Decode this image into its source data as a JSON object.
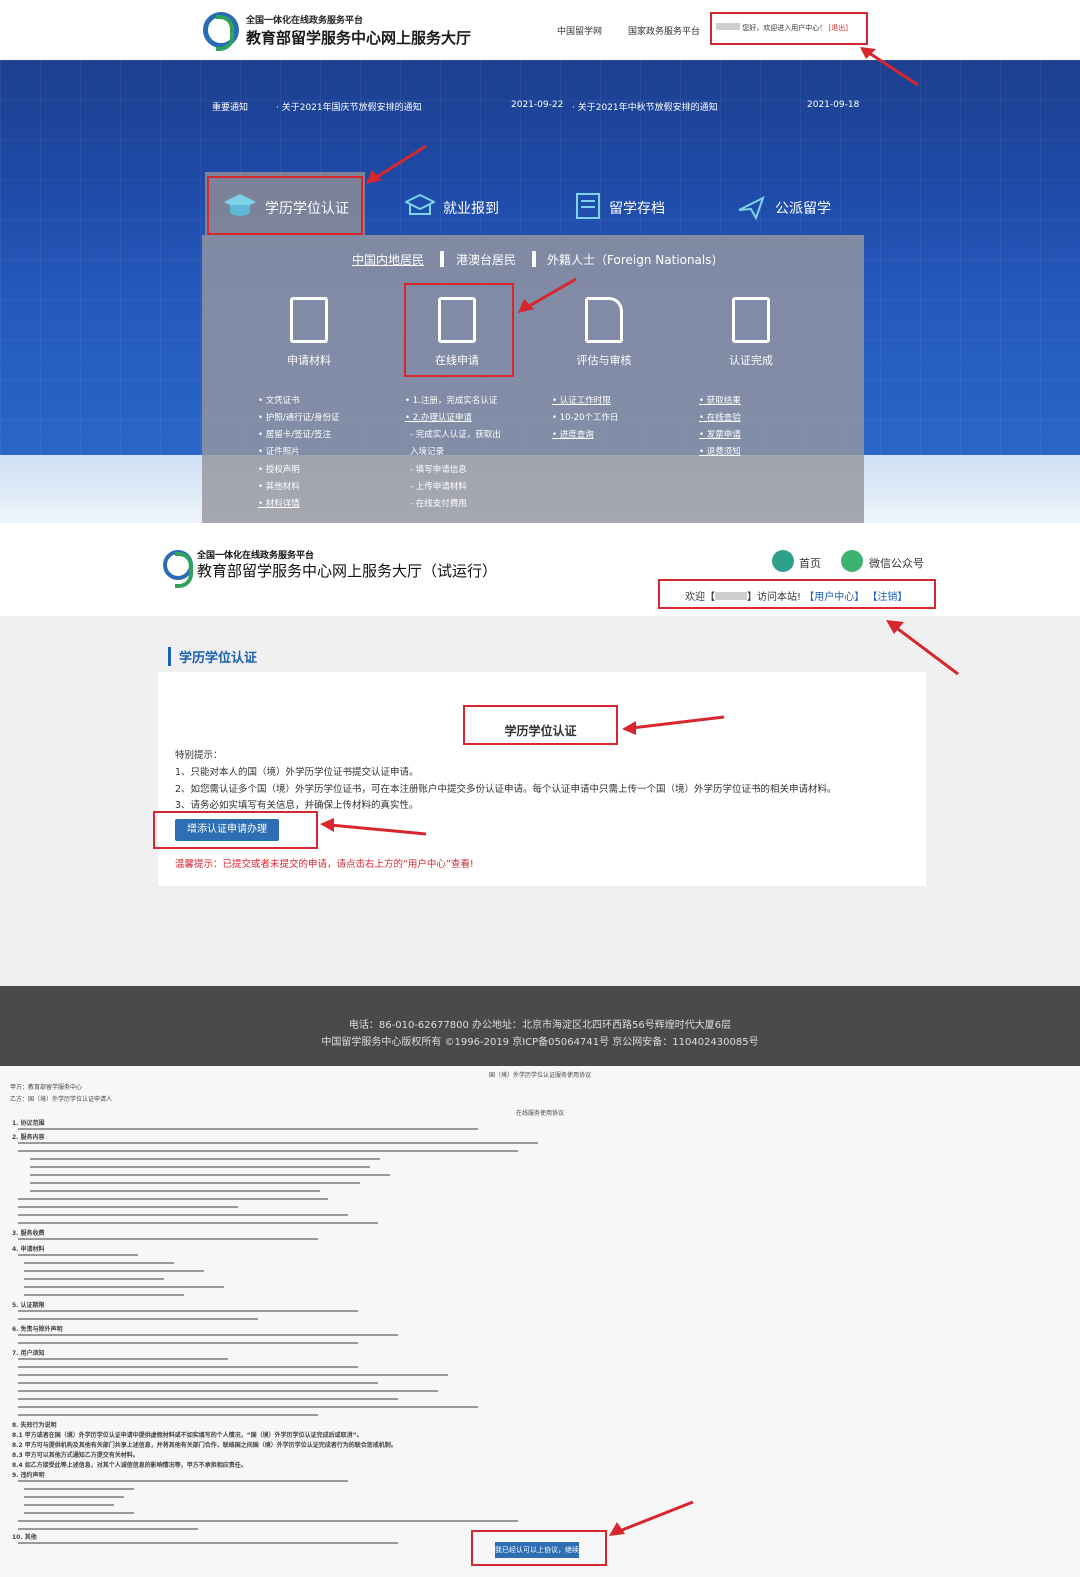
{
  "s1": {
    "logo_sub": "全国一体化在线政务服务平台",
    "logo_main": "教育部留学服务中心网上服务大厅",
    "nav": [
      "中国留学网",
      "国家政务服务平台"
    ],
    "user_greeting": "您好，欢迎进入用户中心！",
    "logout": "[退出]",
    "notice_label": "重要通知",
    "notices": [
      {
        "text": "· 关于2021年国庆节放假安排的通知",
        "date": "2021-09-22"
      },
      {
        "text": "· 关于2021年中秋节放假安排的通知",
        "date": "2021-09-18"
      }
    ],
    "tabs": [
      "学历学位认证",
      "就业报到",
      "留学存档",
      "公派留学"
    ],
    "categories": [
      "中国内地居民",
      "港澳台居民",
      "外籍人士（Foreign Nationals)"
    ],
    "steps": [
      "申请材料",
      "在线申请",
      "评估与审核",
      "认证完成"
    ],
    "col1": [
      "• 文凭证书",
      "• 护照/通行证/身份证",
      "• 居留卡/签证/签注",
      "• 证件照片",
      "• 授权声明",
      "• 其他材料",
      "• 材料详情"
    ],
    "col2": [
      "• 1.注册，完成实名认证",
      "• 2.办理认证申请",
      "- 完成实人认证，获取出",
      "入境记录",
      "- 填写申请信息",
      "- 上传申请材料",
      "- 在线支付费用"
    ],
    "col3": [
      "• 认证工作时限",
      "• 10-20个工作日",
      "• 进度查询"
    ],
    "col4": [
      "• 获取结果",
      "• 在线查验",
      "• 发票申请",
      "• 退费须知"
    ]
  },
  "s2": {
    "logo_sub": "全国一体化在线政务服务平台",
    "logo_main": "教育部留学服务中心网上服务大厅（试运行）",
    "home": "首页",
    "wechat": "微信公众号",
    "welcome_pre": "欢迎【",
    "welcome_post": "】访问本站!",
    "user_center": "【用户中心】",
    "logout": "【注销】",
    "section_title": "学历学位认证",
    "card_title": "学历学位认证",
    "tip_title": "特别提示：",
    "tips": [
      "1、只能对本人的国（境）外学历学位证书提交认证申请。",
      "2、如您需认证多个国（境）外学历学位证书，可在本注册账户中提交多份认证申请。每个认证申请中只需上传一个国（境）外学历学位证书的相关申请材料。",
      "3、请务必如实填写有关信息，并确保上传材料的真实性。"
    ],
    "add_button": "增添认证申请办理",
    "warn": "温馨提示：已提交或者未提交的申请，请点击右上方的“用户中心”查看!"
  },
  "footer": {
    "line1": "电话：86-010-62677800     办公地址：北京市海淀区北四环西路56号辉煌时代大厦6层",
    "line2": "中国留学服务中心版权所有 ©1996-2019     京ICP备05064741号     京公网安备：110402430085号"
  },
  "agreement": {
    "title": "国（境）外学历学位认证服务使用协议",
    "party_a": "甲方：教育部留学服务中心",
    "party_b": "乙方：国（境）外学历学位认证申请人",
    "subtitle": "在线服务使用协议",
    "sections": [
      "1. 协议范围",
      "2. 服务内容",
      "3. 服务收费",
      "4. 申请材料",
      "5. 认证期限",
      "6. 免责与除外声明",
      "7. 用户须知",
      "8. 失效行为说明",
      "9. 违约声明",
      "10. 其他"
    ],
    "bold_lines": [
      "8.1 甲方或者在国（境）外学历学位认证申请中提供虚假材料或不如实填写的个人情况，“国（境）外学历学位认证完成后或取消”。",
      "8.2 甲方可与提供机构及其他有关部门共享上述信息，并将其他有关部门合作，联络国之间国（境）外学历学位认证完成者行为的联合惩戒机制。",
      "8.3 甲方可以其他方式通知乙方提交有关材料。",
      "8.4 如乙方接受此等上述信息，对其个人诚信信息的影响情况等，甲方不承担相应责任。"
    ],
    "confirm_button": "我已经认可以上协议，继续申请"
  },
  "colors": {
    "primary_blue": "#2e6fb3",
    "annotation_red": "#d8262e",
    "footer_bg": "#4a4a4a"
  }
}
